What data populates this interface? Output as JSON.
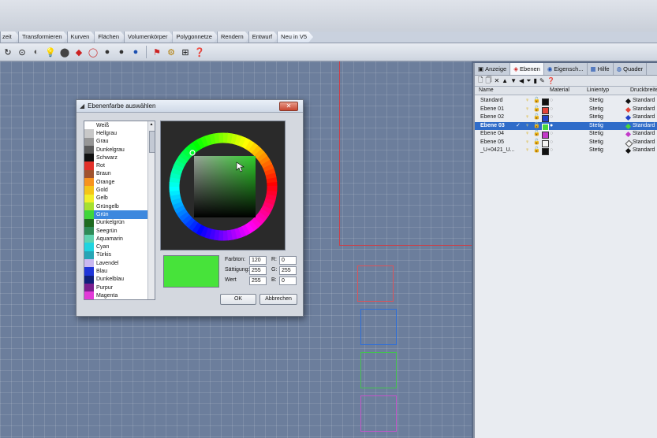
{
  "ribbon_tabs": [
    "Transformieren",
    "Kurven",
    "Flächen",
    "Volumenkörper",
    "Polygonnetze",
    "Rendern",
    "Entwurf",
    "Neu in V5"
  ],
  "ribbon_tab_leading": "zeit",
  "toolbar_icons": [
    "redo-icon",
    "select-icon",
    "lightbulb-icon",
    "sphere-icon",
    "render-icon",
    "circle-icon",
    "torus-icon",
    "sphere-solid-icon",
    "teapot-icon",
    "flag-icon",
    "gear-icon",
    "grid-icon",
    "help-icon"
  ],
  "panel": {
    "tabs": [
      {
        "label": "Anzeige",
        "icon": "display-icon"
      },
      {
        "label": "Ebenen",
        "icon": "layers-icon"
      },
      {
        "label": "Eigensch...",
        "icon": "properties-icon"
      },
      {
        "label": "Hilfe",
        "icon": "help-icon"
      },
      {
        "label": "Quader",
        "icon": "box-icon"
      }
    ],
    "active_tab": "Ebenen",
    "columns": {
      "name": "Name",
      "material": "Material",
      "linetype": "Linientyp",
      "print": "Druckbreite"
    },
    "layers": [
      {
        "name": "Standard",
        "color": "#111111",
        "linetype": "Stetig",
        "print": "Standard",
        "diamond": "#111111",
        "selected": false
      },
      {
        "name": "Ebene 01",
        "color": "#e2443a",
        "linetype": "Stetig",
        "print": "Standard",
        "diamond": "#e2443a",
        "selected": false
      },
      {
        "name": "Ebene 02",
        "color": "#2140c8",
        "linetype": "Stetig",
        "print": "Standard",
        "diamond": "#2140c8",
        "selected": false
      },
      {
        "name": "Ebene 03",
        "color": "#47d63a",
        "linetype": "Stetig",
        "print": "Standard",
        "diamond": "#47d63a",
        "selected": true
      },
      {
        "name": "Ebene 04",
        "color": "#c23ac9",
        "linetype": "Stetig",
        "print": "Standard",
        "diamond": "#c23ac9",
        "selected": false
      },
      {
        "name": "Ebene 05",
        "color": "#f4f4f4",
        "linetype": "Stetig",
        "print": "Standard",
        "diamond": "#f4f4f4",
        "selected": false
      },
      {
        "name": "_U+0421_U...",
        "color": "#111111",
        "linetype": "Stetig",
        "print": "Standard",
        "diamond": "#111111",
        "selected": false
      }
    ]
  },
  "dialog": {
    "title": "Ebenenfarbe auswählen",
    "colors": [
      {
        "name": "Weiß",
        "hex": "#ffffff"
      },
      {
        "name": "Hellgrau",
        "hex": "#c8c8c8"
      },
      {
        "name": "Grau",
        "hex": "#969696"
      },
      {
        "name": "Dunkelgrau",
        "hex": "#5a5a5a"
      },
      {
        "name": "Schwarz",
        "hex": "#111111"
      },
      {
        "name": "Rot",
        "hex": "#e2302a"
      },
      {
        "name": "Braun",
        "hex": "#a0522d"
      },
      {
        "name": "Orange",
        "hex": "#f7931e"
      },
      {
        "name": "Gold",
        "hex": "#f5c518"
      },
      {
        "name": "Gelb",
        "hex": "#f2ef2a"
      },
      {
        "name": "Grüngelb",
        "hex": "#a6e02f"
      },
      {
        "name": "Grün",
        "hex": "#3fd63a"
      },
      {
        "name": "Dunkelgrün",
        "hex": "#1f6b20"
      },
      {
        "name": "Seegrün",
        "hex": "#2e8b57"
      },
      {
        "name": "Aquamarin",
        "hex": "#5fd3b0"
      },
      {
        "name": "Cyan",
        "hex": "#1fd4e0"
      },
      {
        "name": "Türkis",
        "hex": "#26a5b5"
      },
      {
        "name": "Lavendel",
        "hex": "#c9b8f0"
      },
      {
        "name": "Blau",
        "hex": "#1f35d8"
      },
      {
        "name": "Dunkelblau",
        "hex": "#10207a"
      },
      {
        "name": "Purpur",
        "hex": "#7a1f8f"
      },
      {
        "name": "Magenta",
        "hex": "#e23ad8"
      }
    ],
    "selected_color": "Grün",
    "preview_color": "#47e33a",
    "fields": {
      "hue_label": "Farbton:",
      "hue": "120",
      "sat_label": "Sättigung:",
      "sat": "255",
      "val_label": "Wert",
      "val": "255",
      "r_label": "R:",
      "r": "0",
      "g_label": "G:",
      "g": "255",
      "b_label": "B:",
      "b": "0"
    },
    "ok_label": "OK",
    "cancel_label": "Abbrechen"
  },
  "viewport_squares": [
    {
      "color": "#d9545b"
    },
    {
      "color": "#2f6fd8"
    },
    {
      "color": "#43c24f"
    },
    {
      "color": "#c355c9"
    }
  ]
}
